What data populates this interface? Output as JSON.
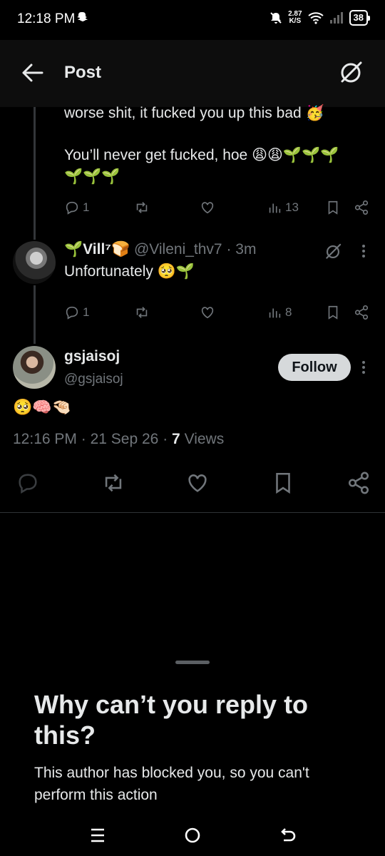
{
  "status": {
    "time": "12:18 PM",
    "speed_value": "2.87",
    "speed_unit": "K/S",
    "battery": "38"
  },
  "header": {
    "title": "Post"
  },
  "parent_tweet": {
    "text_line1": "worse shit, it fucked you up this bad 🥳",
    "text_line2": "You’ll never get fucked, hoe 😩😩🌱🌱🌱",
    "text_line3": "🌱🌱🌱",
    "replies": "1",
    "views": "13"
  },
  "reply_tweet": {
    "display_name": "🌱Vill⁷🍞",
    "handle_time": "@Vileni_thv7 · 3m",
    "text": "Unfortunately 🥺🌱",
    "replies": "1",
    "views": "8"
  },
  "main_tweet": {
    "display_name": "gsjaisoj",
    "handle": "@gsjaisoj",
    "follow_label": "Follow",
    "text": "🥺🧠🤏🏻",
    "time": "12:16 PM",
    "date": "21 Sep 26",
    "views_count": "7",
    "views_label": "Views"
  },
  "sheet": {
    "title": "Why can’t you reply to this?",
    "body": "This author has blocked you, so you can't perform this action"
  },
  "colors": {
    "background": "#000000",
    "text_primary": "#e7e9ea",
    "text_secondary": "#71767b",
    "follow_bg": "#d6d9db"
  }
}
